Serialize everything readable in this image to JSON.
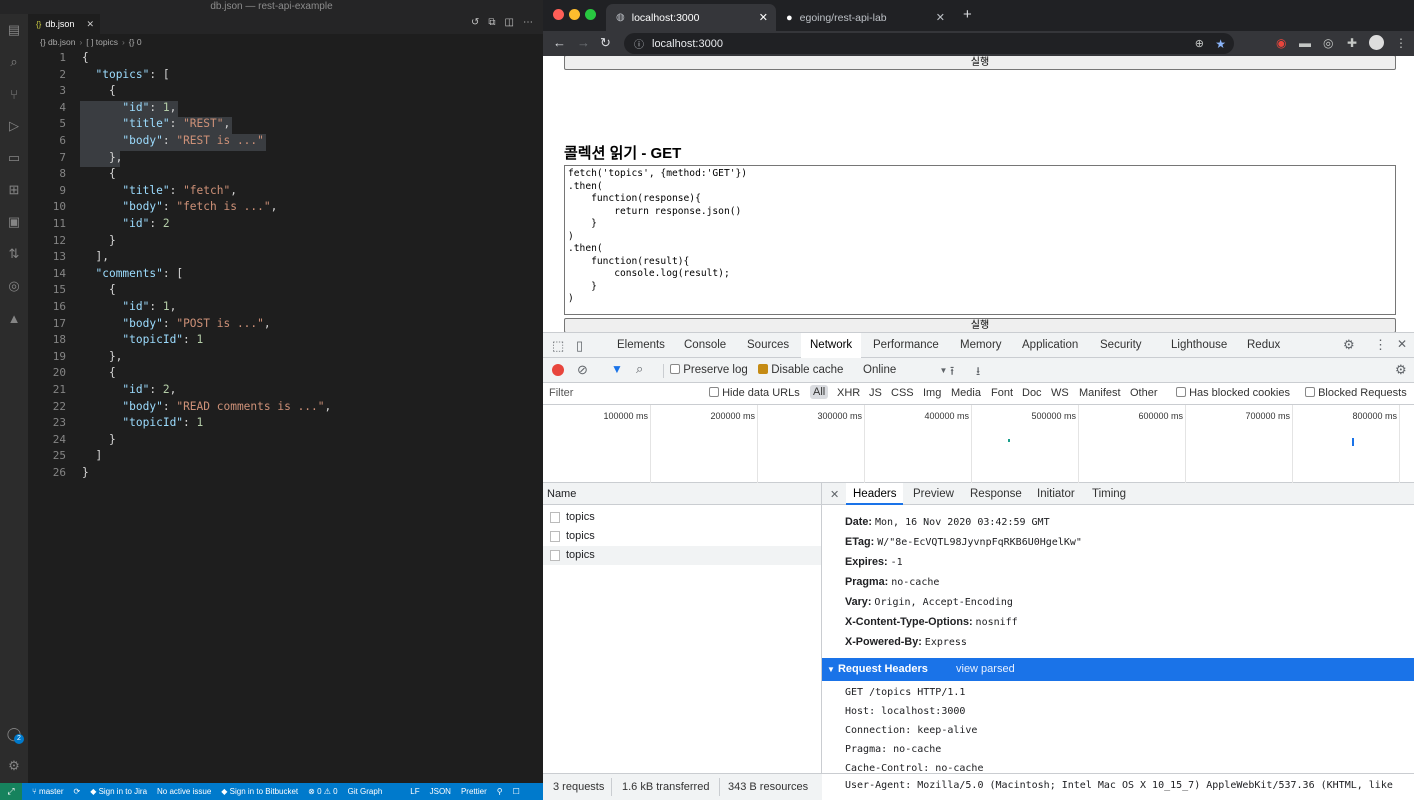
{
  "vscode": {
    "window_title": "db.json — rest-api-example",
    "tab": {
      "label": "db.json",
      "icon": "{}"
    },
    "breadcrumb": [
      "{} db.json",
      "[ ] topics",
      "{} 0"
    ],
    "lines": [
      {
        "n": "1"
      },
      {
        "n": "2"
      },
      {
        "n": "3"
      },
      {
        "n": "4"
      },
      {
        "n": "5"
      },
      {
        "n": "6"
      },
      {
        "n": "7"
      },
      {
        "n": "8"
      },
      {
        "n": "9"
      },
      {
        "n": "10"
      },
      {
        "n": "11"
      },
      {
        "n": "12"
      },
      {
        "n": "13"
      },
      {
        "n": "14"
      },
      {
        "n": "15"
      },
      {
        "n": "16"
      },
      {
        "n": "17"
      },
      {
        "n": "18"
      },
      {
        "n": "19"
      },
      {
        "n": "20"
      },
      {
        "n": "21"
      },
      {
        "n": "22"
      },
      {
        "n": "23"
      },
      {
        "n": "24"
      },
      {
        "n": "25"
      },
      {
        "n": "26"
      }
    ],
    "code": [
      "{",
      "  \"topics\": [",
      "    {",
      "      \"id\": 1,",
      "      \"title\": \"REST\",",
      "      \"body\": \"REST is ...\"",
      "    },",
      "    {",
      "      \"title\": \"fetch\",",
      "      \"body\": \"fetch is ...\",",
      "      \"id\": 2",
      "    }",
      "  ],",
      "  \"comments\": [",
      "    {",
      "      \"id\": 1,",
      "      \"body\": \"POST is ...\",",
      "      \"topicId\": 1",
      "    },",
      "    {",
      "      \"id\": 2,",
      "      \"body\": \"READ comments is ...\",",
      "      \"topicId\": 1",
      "    }",
      "  ]",
      "}"
    ],
    "status": {
      "branch": "master",
      "jira": "Sign in to Jira",
      "issue": "No active issue",
      "bitbucket": "Sign in to Bitbucket",
      "problems": "⊗ 0 ⚠ 0",
      "gitgraph": "Git Graph",
      "eol": "LF",
      "lang": "JSON",
      "prettier": "Prettier",
      "accounts_badge": "2"
    }
  },
  "chrome": {
    "tabs": [
      {
        "label": "localhost:3000"
      },
      {
        "label": "egoing/rest-api-lab"
      }
    ],
    "url": "localhost:3000",
    "page": {
      "run_button": "실행",
      "heading": "콜렉션 읽기 - GET",
      "code": "fetch('topics', {method:'GET'})\n.then(\n    function(response){\n        return response.json()\n    }\n)\n.then(\n    function(result){\n        console.log(result);\n    }\n)"
    }
  },
  "devtools": {
    "tabs": [
      "Elements",
      "Console",
      "Sources",
      "Network",
      "Performance",
      "Memory",
      "Application",
      "Security",
      "Lighthouse",
      "Redux"
    ],
    "active_tab": "Network",
    "toolbar": {
      "preserve_log": "Preserve log",
      "disable_cache": "Disable cache",
      "throttle": "Online"
    },
    "filter": {
      "placeholder": "Filter",
      "hide_data_urls": "Hide data URLs",
      "types": [
        "All",
        "XHR",
        "JS",
        "CSS",
        "Img",
        "Media",
        "Font",
        "Doc",
        "WS",
        "Manifest",
        "Other"
      ],
      "blocked_cookies": "Has blocked cookies",
      "blocked_requests": "Blocked Requests"
    },
    "timeline_ticks": [
      "100000 ms",
      "200000 ms",
      "300000 ms",
      "400000 ms",
      "500000 ms",
      "600000 ms",
      "700000 ms",
      "800000 ms"
    ],
    "name_header": "Name",
    "requests": [
      "topics",
      "topics",
      "topics"
    ],
    "detail_tabs": [
      "Headers",
      "Preview",
      "Response",
      "Initiator",
      "Timing"
    ],
    "response_headers": [
      {
        "k": "Date:",
        "v": "Mon, 16 Nov 2020 03:42:59 GMT"
      },
      {
        "k": "ETag:",
        "v": "W/\"8e-EcVQTL98JyvnpFqRKB6U0HgelKw\""
      },
      {
        "k": "Expires:",
        "v": "-1"
      },
      {
        "k": "Pragma:",
        "v": "no-cache"
      },
      {
        "k": "Vary:",
        "v": "Origin, Accept-Encoding"
      },
      {
        "k": "X-Content-Type-Options:",
        "v": "nosniff"
      },
      {
        "k": "X-Powered-By:",
        "v": "Express"
      }
    ],
    "request_headers_label": "Request Headers",
    "view_parsed": "view parsed",
    "raw_request": [
      "GET /topics HTTP/1.1",
      "Host: localhost:3000",
      "Connection: keep-alive",
      "Pragma: no-cache",
      "Cache-Control: no-cache",
      "User-Agent: Mozilla/5.0 (Macintosh; Intel Mac OS X 10_15_7) AppleWebKit/537.36 (KHTML, like"
    ],
    "status": {
      "requests": "3 requests",
      "transferred": "1.6 kB transferred",
      "resources": "343 B resources"
    }
  },
  "colors": {
    "vscode_blue": "#007acc",
    "chrome_blue": "#1a73e8",
    "record_red": "#e8453c"
  }
}
